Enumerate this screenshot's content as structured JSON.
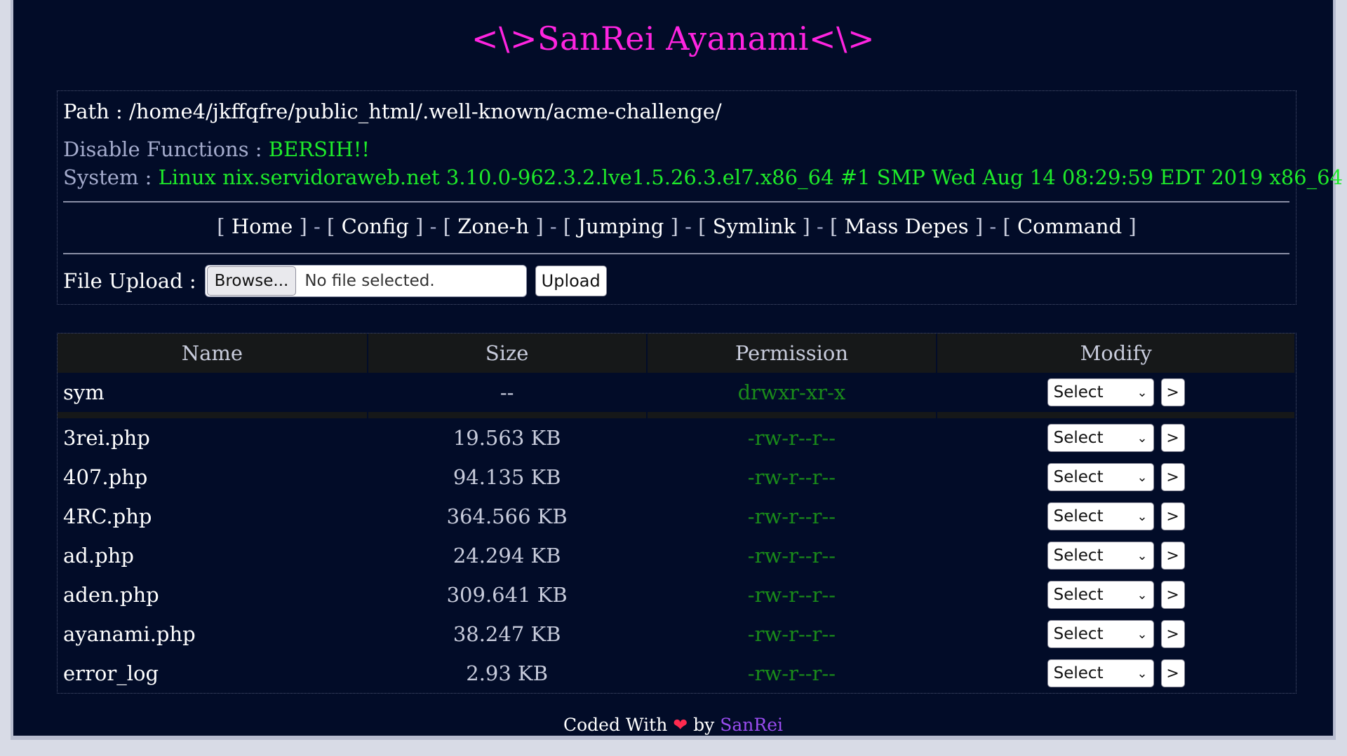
{
  "title": "<\\>SanRei Ayanami<\\>",
  "info": {
    "path_label": "Path : ",
    "path_value": "/home4/jkffqfre/public_html/.well-known/acme-challenge/",
    "disable_label": "Disable Functions : ",
    "disable_value": "BERSIH!!",
    "system_label": "System : ",
    "system_value": "Linux nix.servidoraweb.net 3.10.0-962.3.2.lve1.5.26.3.el7.x86_64 #1 SMP Wed Aug 14 08:29:59 EDT 2019 x86_64"
  },
  "nav": {
    "items": [
      "Home",
      "Config",
      "Zone-h",
      "Jumping",
      "Symlink",
      "Mass Depes",
      "Command"
    ],
    "separator": "-"
  },
  "upload": {
    "label": "File Upload :",
    "browse_label": "Browse...",
    "file_status": "No file selected.",
    "upload_label": "Upload"
  },
  "table": {
    "headers": [
      "Name",
      "Size",
      "Permission",
      "Modify"
    ],
    "rows": [
      {
        "name": "sym",
        "size": "--",
        "perm": "drwxr-xr-x"
      },
      {
        "name": "3rei.php",
        "size": "19.563 KB",
        "perm": "-rw-r--r--"
      },
      {
        "name": "407.php",
        "size": "94.135 KB",
        "perm": "-rw-r--r--"
      },
      {
        "name": "4RC.php",
        "size": "364.566 KB",
        "perm": "-rw-r--r--"
      },
      {
        "name": "ad.php",
        "size": "24.294 KB",
        "perm": "-rw-r--r--"
      },
      {
        "name": "aden.php",
        "size": "309.641 KB",
        "perm": "-rw-r--r--"
      },
      {
        "name": "ayanami.php",
        "size": "38.247 KB",
        "perm": "-rw-r--r--"
      },
      {
        "name": "error_log",
        "size": "2.93 KB",
        "perm": "-rw-r--r--"
      }
    ],
    "select_label": "Select",
    "go_label": ">"
  },
  "footer": {
    "prefix": "Coded With",
    "by": "by",
    "author": "SanRei"
  },
  "colors": {
    "background": "#020c28",
    "title": "#ff24e0",
    "green": "#1eea2a",
    "perm_green": "#1a8b1a",
    "author": "#9a4cf0"
  }
}
